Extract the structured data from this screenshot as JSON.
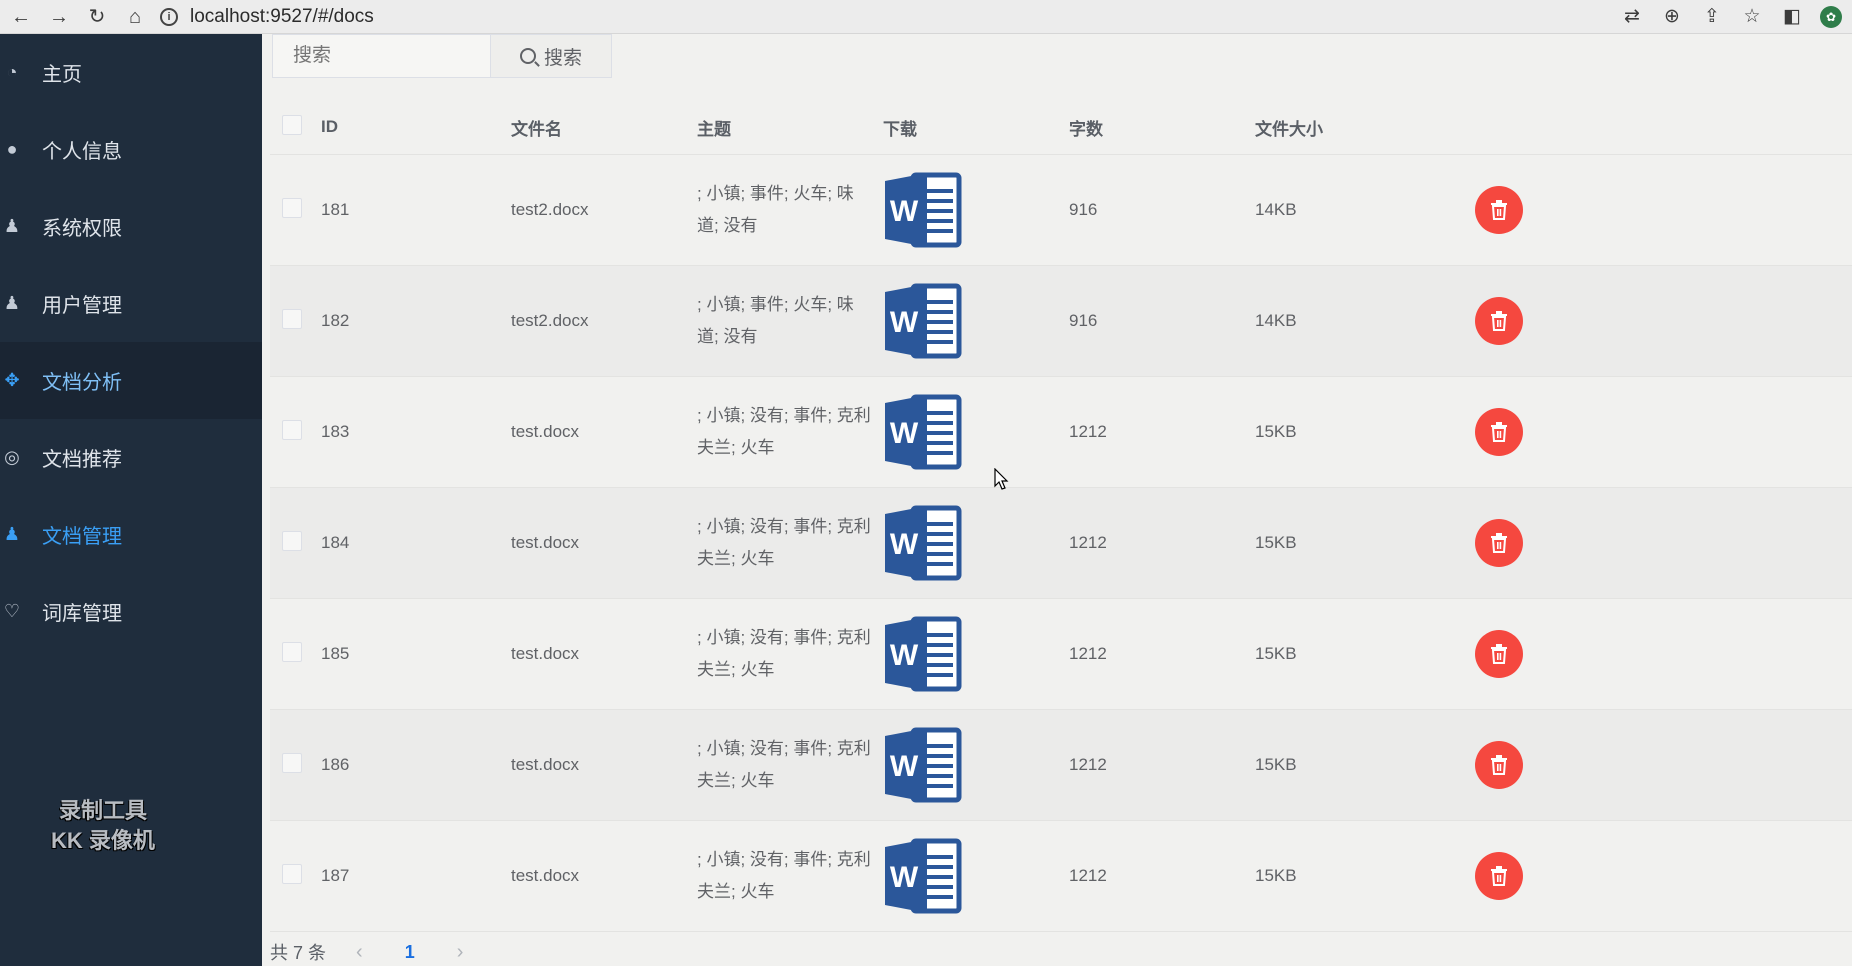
{
  "browser": {
    "url": "localhost:9527/#/docs",
    "nav": [
      "←",
      "→",
      "↻",
      "⌂"
    ],
    "tools": [
      "translate-icon",
      "zoom-icon",
      "share-icon",
      "star-icon",
      "sidebar-icon",
      "extension-icon"
    ]
  },
  "sidebar": {
    "items": [
      {
        "label": "主页",
        "icon": "dashboard-icon"
      },
      {
        "label": "个人信息",
        "icon": "user-icon"
      },
      {
        "label": "系统权限",
        "icon": "user-key-icon"
      },
      {
        "label": "用户管理",
        "icon": "users-icon"
      },
      {
        "label": "文档分析",
        "icon": "move-icon"
      },
      {
        "label": "文档推荐",
        "icon": "compass-icon"
      },
      {
        "label": "文档管理",
        "icon": "users-icon"
      },
      {
        "label": "词库管理",
        "icon": "heart-icon"
      }
    ],
    "active": "文档管理",
    "watermark_line1": "录制工具",
    "watermark_line2": "KK 录像机"
  },
  "search": {
    "placeholder": "搜索",
    "button_label": "搜索"
  },
  "table": {
    "headers": {
      "id": "ID",
      "filename": "文件名",
      "topic": "主题",
      "download": "下载",
      "words": "字数",
      "size": "文件大小"
    },
    "rows": [
      {
        "id": "181",
        "filename": "test2.docx",
        "topic": "; 小镇; 事件; 火车; 味道; 没有",
        "words": "916",
        "size": "14KB"
      },
      {
        "id": "182",
        "filename": "test2.docx",
        "topic": "; 小镇; 事件; 火车; 味道; 没有",
        "words": "916",
        "size": "14KB"
      },
      {
        "id": "183",
        "filename": "test.docx",
        "topic": "; 小镇; 没有; 事件; 克利夫兰; 火车",
        "words": "1212",
        "size": "15KB"
      },
      {
        "id": "184",
        "filename": "test.docx",
        "topic": "; 小镇; 没有; 事件; 克利夫兰; 火车",
        "words": "1212",
        "size": "15KB"
      },
      {
        "id": "185",
        "filename": "test.docx",
        "topic": "; 小镇; 没有; 事件; 克利夫兰; 火车",
        "words": "1212",
        "size": "15KB"
      },
      {
        "id": "186",
        "filename": "test.docx",
        "topic": "; 小镇; 没有; 事件; 克利夫兰; 火车",
        "words": "1212",
        "size": "15KB"
      },
      {
        "id": "187",
        "filename": "test.docx",
        "topic": "; 小镇; 没有; 事件; 克利夫兰; 火车",
        "words": "1212",
        "size": "15KB"
      }
    ]
  },
  "pagination": {
    "total": "共 7 条",
    "current_page": "1",
    "prev": "‹",
    "next": "›"
  },
  "colors": {
    "sidebar_bg": "#1f2d3d",
    "active": "#3a9ff5",
    "delete": "#f5483f",
    "word_blue": "#2b579a"
  }
}
